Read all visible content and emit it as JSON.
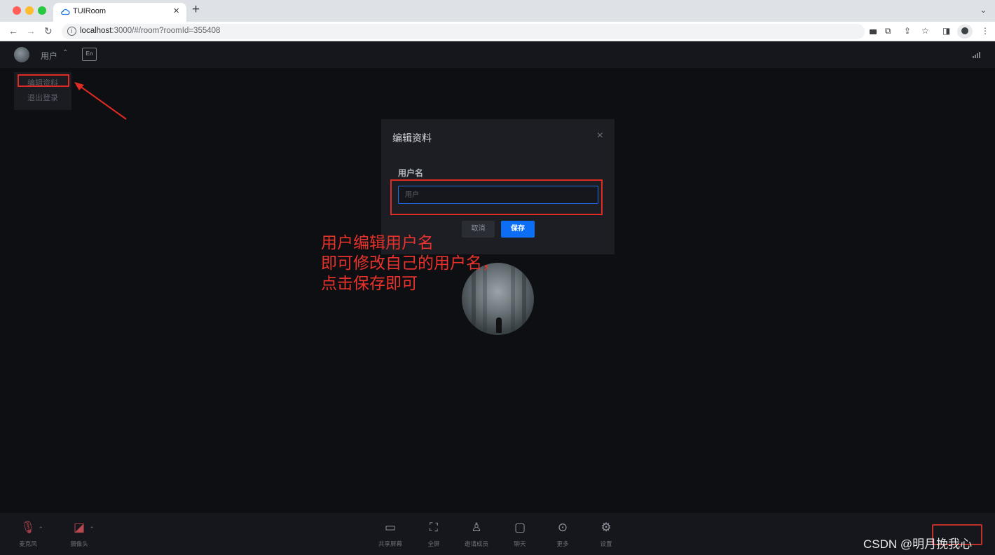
{
  "browser": {
    "tab_title": "TUIRoom",
    "url_host": "localhost",
    "url_rest": ":3000/#/room?roomId=355408"
  },
  "header": {
    "user_name": "用户",
    "lang_label": "En"
  },
  "user_menu": {
    "items": [
      {
        "label": "编辑资料"
      },
      {
        "label": "退出登录"
      }
    ]
  },
  "modal": {
    "title": "编辑资料",
    "field_label": "用户名",
    "input_placeholder": "用户",
    "input_value": "",
    "cancel_label": "取消",
    "save_label": "保存"
  },
  "annotation": {
    "text": "用户编辑用户名\n即可修改自己的用户名，\n点击保存即可",
    "color": "#e8322b"
  },
  "toolbar": {
    "left": [
      {
        "label": "麦克风",
        "icon": "mic-muted-icon"
      },
      {
        "label": "摄像头",
        "icon": "camera-off-icon"
      }
    ],
    "center": [
      {
        "label": "共享屏幕",
        "icon": "share-screen-icon"
      },
      {
        "label": "全屏",
        "icon": "fullscreen-icon"
      },
      {
        "label": "邀请成员",
        "icon": "invite-icon"
      },
      {
        "label": "聊天",
        "icon": "chat-icon"
      },
      {
        "label": "更多",
        "icon": "more-icon"
      },
      {
        "label": "设置",
        "icon": "settings-icon"
      }
    ]
  },
  "watermark": "CSDN @明月挽我心",
  "colors": {
    "accent": "#0b6ef5",
    "highlight_red": "#e02a24",
    "background": "#0e0f13"
  }
}
